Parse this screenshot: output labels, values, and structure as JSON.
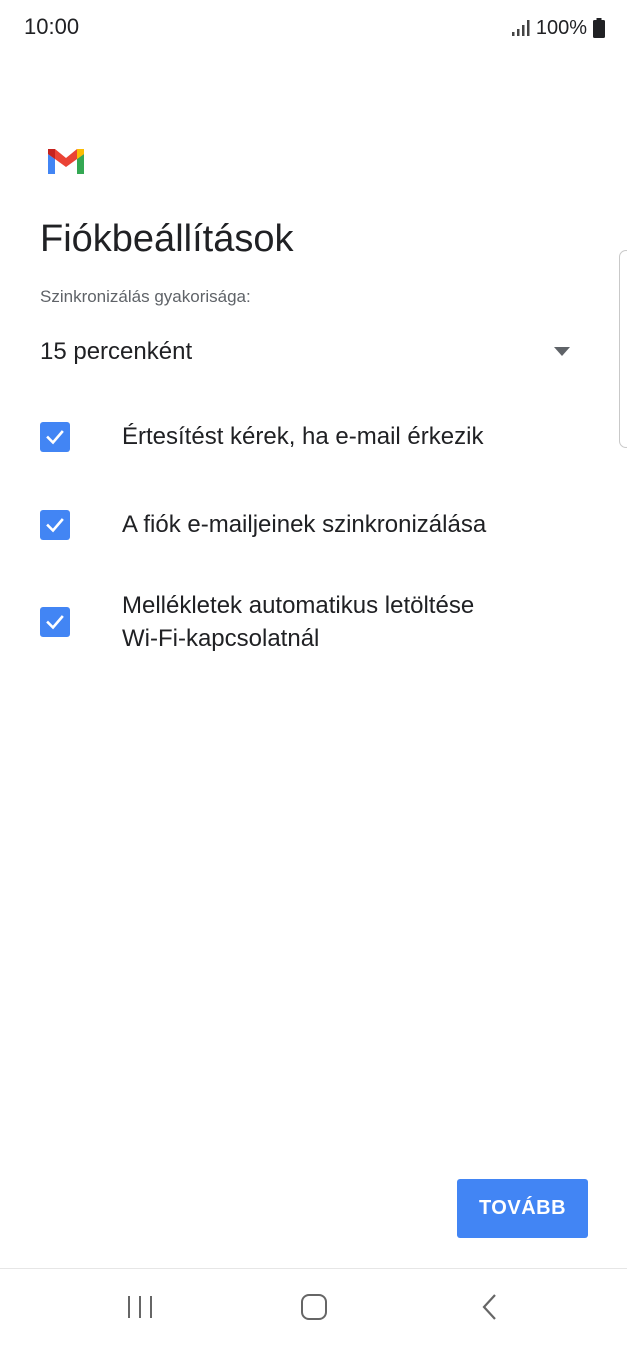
{
  "status_bar": {
    "time": "10:00",
    "battery": "100%",
    "icons": [
      "signal-icon",
      "battery-icon"
    ]
  },
  "header": {
    "logo": "gmail-logo",
    "title": "Fiókbeállítások"
  },
  "sync": {
    "label": "Szinkronizálás gyakorisága:",
    "selected": "15 percenként",
    "icon": "dropdown-arrow-icon"
  },
  "options": [
    {
      "lines": [
        "Értesítést kérek, ha e-mail érkezik"
      ],
      "checked": true
    },
    {
      "lines": [
        "A fiók e-mailjeinek szinkronizálása"
      ],
      "checked": true
    },
    {
      "lines": [
        "Mellékletek automatikus letöltése",
        "Wi-Fi-kapcsolatnál"
      ],
      "checked": true
    }
  ],
  "actions": {
    "next_label": "TOVÁBB"
  },
  "nav_bar": {
    "icons": [
      "recent-apps-icon",
      "home-icon",
      "back-icon"
    ]
  },
  "colors": {
    "accent": "#4285f4",
    "text": "#202124",
    "secondary_text": "#5f6368"
  }
}
